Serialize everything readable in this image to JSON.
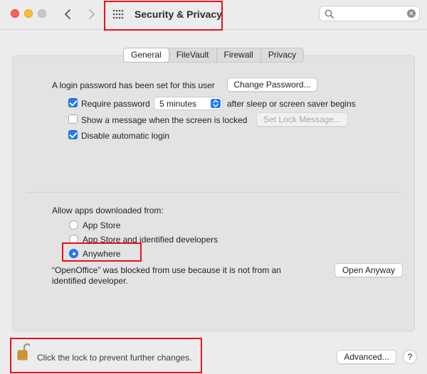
{
  "window": {
    "title": "Security & Privacy"
  },
  "search": {
    "value": "",
    "placeholder": ""
  },
  "tabs": [
    {
      "label": "General",
      "active": true
    },
    {
      "label": "FileVault",
      "active": false
    },
    {
      "label": "Firewall",
      "active": false
    },
    {
      "label": "Privacy",
      "active": false
    }
  ],
  "general": {
    "login_text": "A login password has been set for this user",
    "change_password_label": "Change Password...",
    "require_password": {
      "label": "Require password",
      "checked": true
    },
    "require_password_delay": "5 minutes",
    "after_sleep_text": "after sleep or screen saver begins",
    "show_message": {
      "label": "Show a message when the screen is locked",
      "checked": false
    },
    "set_lock_message_label": "Set Lock Message...",
    "disable_auto_login": {
      "label": "Disable automatic login",
      "checked": true
    }
  },
  "allow_apps": {
    "heading": "Allow apps downloaded from:",
    "options": [
      {
        "label": "App Store",
        "selected": false
      },
      {
        "label": "App Store and identified developers",
        "selected": false
      },
      {
        "label": "Anywhere",
        "selected": true
      }
    ],
    "blocked_line1": "“OpenOffice” was blocked from use because it is not from an",
    "blocked_line2": "identified developer.",
    "open_anyway_label": "Open Anyway"
  },
  "footer": {
    "lock_text": "Click the lock to prevent further changes.",
    "advanced_label": "Advanced...",
    "help_label": "?"
  },
  "colors": {
    "accent": "#1f7bf3",
    "highlight": "#e8121a"
  }
}
